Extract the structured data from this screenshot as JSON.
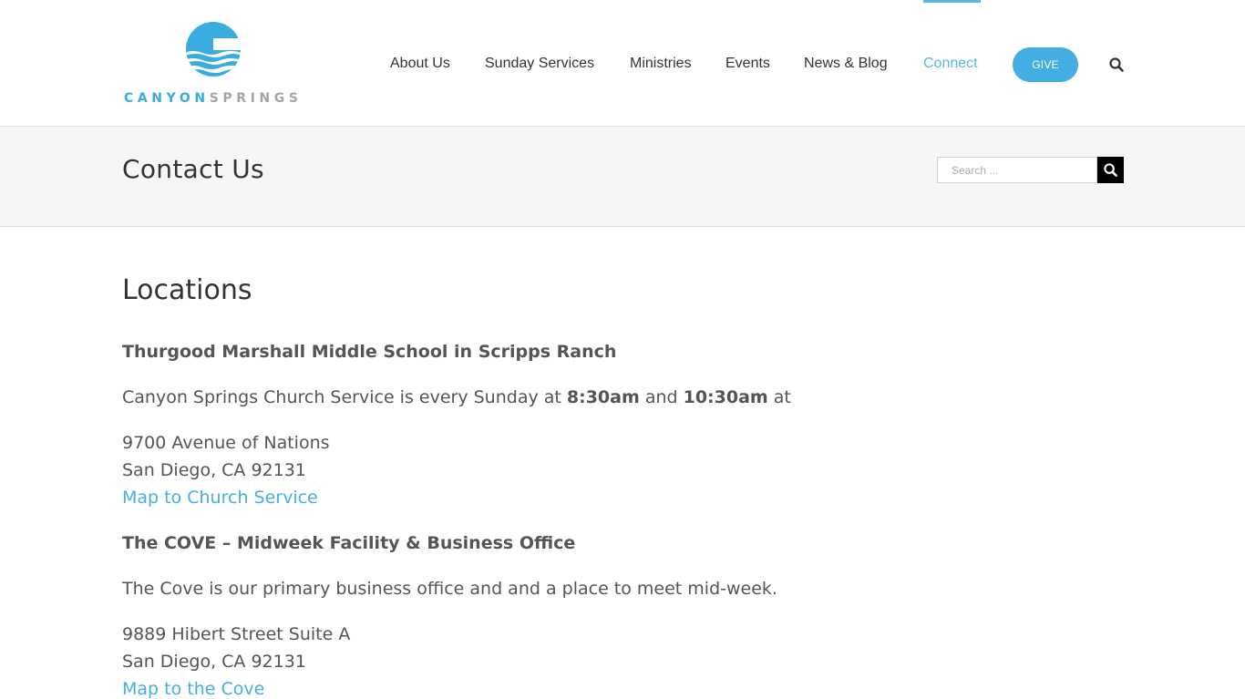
{
  "brand": {
    "name_part1": "CANYON",
    "name_part2": "SPRINGS",
    "logo_color": "#3aace0",
    "logo_text_gray": "#a5a5a5"
  },
  "nav": {
    "items": [
      {
        "label": "About Us",
        "active": false
      },
      {
        "label": "Sunday Services",
        "active": false
      },
      {
        "label": "Ministries",
        "active": false
      },
      {
        "label": "Events",
        "active": false
      },
      {
        "label": "News & Blog",
        "active": false
      },
      {
        "label": "Connect",
        "active": true
      }
    ],
    "give_label": "GIVE",
    "search_icon": "search-icon",
    "accent_color": "#58b6df",
    "give_color": "#44ade2"
  },
  "titlebar": {
    "title": "Contact Us",
    "search_placeholder": "Search ..."
  },
  "content": {
    "heading": "Locations",
    "locations": [
      {
        "title": "Thurgood Marshall Middle School in Scripps Ranch",
        "desc_prefix": "Canyon Springs Church Service is every Sunday at ",
        "time1": "8:30am",
        "desc_mid": " and ",
        "time2": "10:30am",
        "desc_suffix": " at",
        "address_line1": "9700 Avenue of Nations",
        "address_line2": "San Diego, CA 92131",
        "map_link": "Map to Church Service"
      },
      {
        "title": "The COVE – Midweek Facility & Business Office",
        "desc": "The Cove is our primary business office and and a place to meet mid-week.",
        "address_line1": "9889 Hibert Street Suite A",
        "address_line2": "San Diego, CA 92131",
        "map_link": "Map to the Cove"
      }
    ],
    "link_color": "#48aede"
  }
}
